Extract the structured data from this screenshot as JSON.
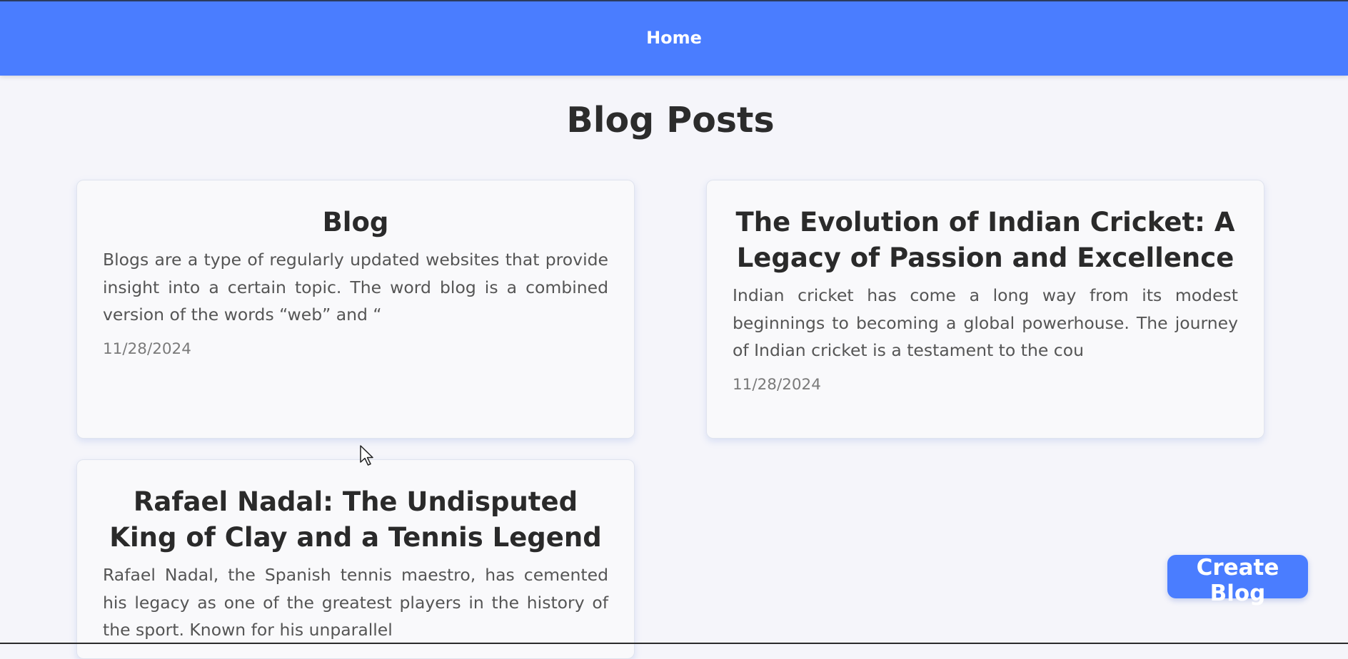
{
  "nav": {
    "home_label": "Home"
  },
  "page": {
    "title": "Blog Posts"
  },
  "posts": [
    {
      "title": "Blog",
      "excerpt": "Blogs are a type of regularly updated websites that provide insight into a certain topic. The word blog is a combined version of the words “web” and “",
      "date": "11/28/2024"
    },
    {
      "title": "The Evolution of Indian Cricket: A Legacy of Passion and Excellence",
      "excerpt": "Indian cricket has come a long way from its modest beginnings to becoming a global powerhouse. The journey of Indian cricket is a testament to the cou",
      "date": "11/28/2024"
    },
    {
      "title": "Rafael Nadal: The Undisputed King of Clay and a Tennis Legend",
      "excerpt": "Rafael Nadal, the Spanish tennis maestro, has cemented his legacy as one of the greatest players in the history of the sport. Known for his unparallel"
    }
  ],
  "actions": {
    "create_label": "Create Blog"
  },
  "colors": {
    "accent": "#4a7dff",
    "background": "#f5f5fa",
    "card": "#f9f9fb"
  },
  "icons": {
    "cursor": "mouse-pointer-icon"
  }
}
